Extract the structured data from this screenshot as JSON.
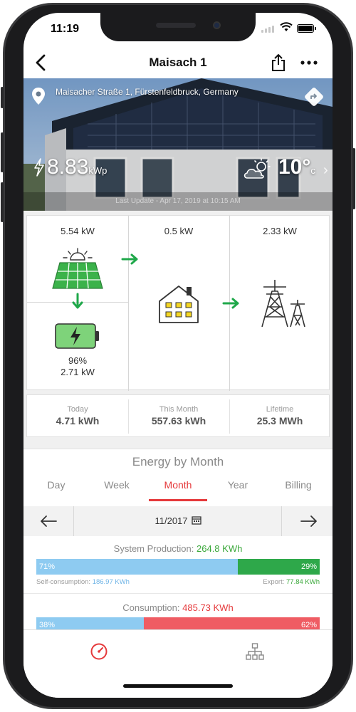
{
  "status_bar": {
    "time": "11:19"
  },
  "nav": {
    "title": "Maisach 1"
  },
  "hero": {
    "address": "Maisacher Straße 1, Fürstenfeldbruck, Germany",
    "power_value": "8.83",
    "power_unit": "kWp",
    "temperature_value": "10°",
    "temperature_unit": "c",
    "last_update": "Last Update - Apr 17, 2019 at 10:15 AM"
  },
  "flow": {
    "solar_power": "5.54 kW",
    "battery_percent": "96%",
    "battery_power": "2.71 kW",
    "home_power": "0.5 kW",
    "grid_power": "2.33 kW"
  },
  "stats": [
    {
      "label": "Today",
      "value": "4.71 kWh"
    },
    {
      "label": "This Month",
      "value": "557.63 kWh"
    },
    {
      "label": "Lifetime",
      "value": "25.3 MWh"
    }
  ],
  "energy": {
    "heading": "Energy by Month",
    "tabs": [
      {
        "label": "Day"
      },
      {
        "label": "Week"
      },
      {
        "label": "Month"
      },
      {
        "label": "Year"
      },
      {
        "label": "Billing"
      }
    ],
    "active_tab": "Month",
    "date": "11/2017",
    "production": {
      "label": "System Production:",
      "value": "264.8 KWh",
      "self_pct_label": "71%",
      "self_pct": 71,
      "export_pct_label": "29%",
      "export_pct": 29,
      "self_label": "Self-consumption:",
      "self_value": "186.97 KWh",
      "export_label": "Export:",
      "export_value": "77.84 KWh"
    },
    "consumption": {
      "label": "Consumption:",
      "value": "485.73 KWh",
      "left_pct_label": "38%",
      "left_pct": 38,
      "right_pct_label": "62%",
      "right_pct": 62
    }
  },
  "colors": {
    "accent_red": "#e5393b",
    "green": "#2ea84a",
    "blue_bar": "#8ecbf1",
    "red_bar": "#ef5c63",
    "solar_panel": "#3bb24a"
  }
}
